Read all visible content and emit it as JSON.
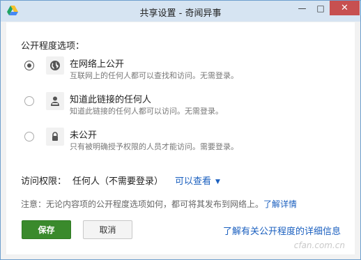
{
  "window": {
    "title": "共享设置 - 奇闻异事",
    "minimize_symbol": "—",
    "maximize_symbol": "□",
    "close_symbol": "✕"
  },
  "dialog": {
    "section_label": "公开程度选项：",
    "options": [
      {
        "icon": "globe-icon",
        "title": "在网络上公开",
        "desc": "互联网上的任何人都可以查找和访问。无需登录。",
        "selected": true
      },
      {
        "icon": "person-link-icon",
        "title": "知道此链接的任何人",
        "desc": "知道此链接的任何人都可以访问。无需登录。",
        "selected": false
      },
      {
        "icon": "lock-icon",
        "title": "未公开",
        "desc": "只有被明确授予权限的人员才能访问。需要登录。",
        "selected": false
      }
    ],
    "access": {
      "label": "访问权限：",
      "value": "任何人（不需要登录）",
      "dropdown": "可以查看"
    },
    "notice": {
      "text": "注意：无论内容项的公开程度选项如何，都可将其发布到网络上。",
      "link": "了解详情"
    },
    "buttons": {
      "save": "保存",
      "cancel": "取消"
    },
    "learn_more": "了解有关公开程度的详细信息"
  },
  "watermark": "cfan.com.cn",
  "colors": {
    "accent_link": "#1a5fbf",
    "save_button": "#3a8a2c",
    "close_button": "#c75050",
    "titlebar": "#d6e4f2"
  }
}
